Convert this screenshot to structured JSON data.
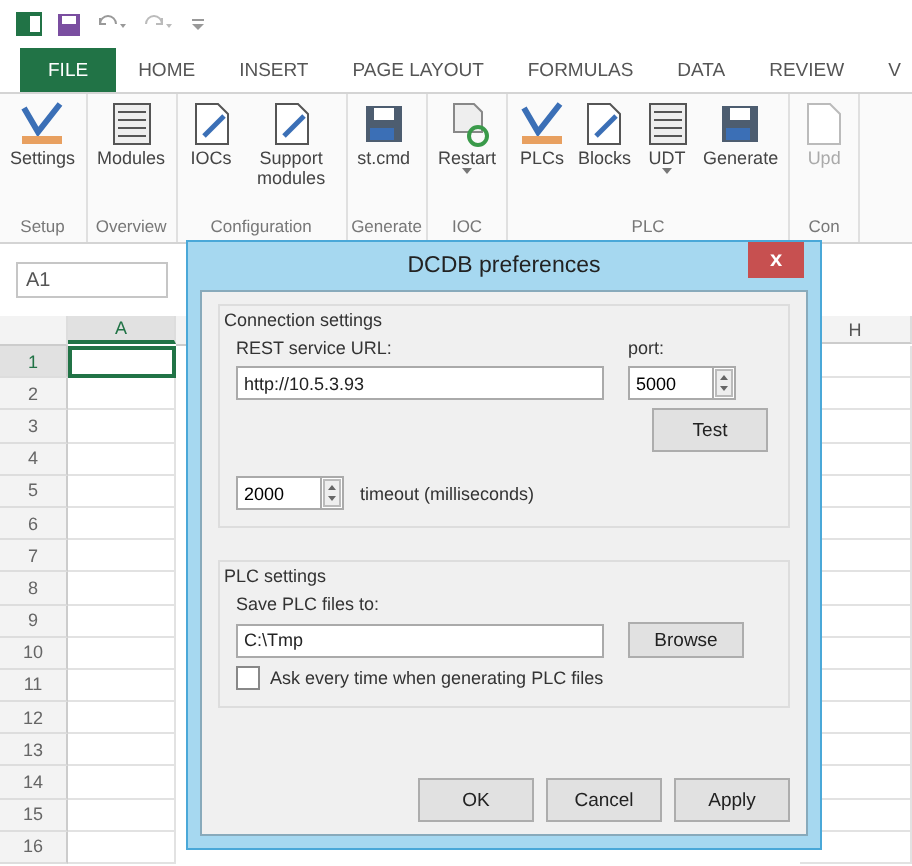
{
  "tabs": [
    {
      "label": "FILE",
      "kind": "file"
    },
    {
      "label": "HOME",
      "kind": "tab"
    },
    {
      "label": "INSERT",
      "kind": "tab"
    },
    {
      "label": "PAGE LAYOUT",
      "kind": "tab"
    },
    {
      "label": "FORMULAS",
      "kind": "tab"
    },
    {
      "label": "DATA",
      "kind": "tab"
    },
    {
      "label": "REVIEW",
      "kind": "tab"
    },
    {
      "label": "V",
      "kind": "tab"
    }
  ],
  "ribbon_groups": [
    {
      "label": "Setup",
      "buttons": [
        {
          "label": "Settings",
          "kind": "settings",
          "dropdown": false,
          "disabled": false
        }
      ]
    },
    {
      "label": "Overview",
      "buttons": [
        {
          "label": "Modules",
          "kind": "list",
          "dropdown": false,
          "disabled": false
        }
      ]
    },
    {
      "label": "Configuration",
      "buttons": [
        {
          "label": "IOCs",
          "kind": "doc",
          "dropdown": false,
          "disabled": false
        },
        {
          "label": "Support modules",
          "kind": "doc",
          "dropdown": false,
          "disabled": false
        }
      ]
    },
    {
      "label": "Generate",
      "buttons": [
        {
          "label": "st.cmd",
          "kind": "save",
          "dropdown": false,
          "disabled": false
        }
      ]
    },
    {
      "label": "IOC",
      "buttons": [
        {
          "label": "Restart",
          "kind": "restart",
          "dropdown": true,
          "disabled": false
        }
      ]
    },
    {
      "label": "PLC",
      "buttons": [
        {
          "label": "PLCs",
          "kind": "settings",
          "dropdown": false,
          "disabled": false
        },
        {
          "label": "Blocks",
          "kind": "doc",
          "dropdown": false,
          "disabled": false
        },
        {
          "label": "UDT",
          "kind": "list",
          "dropdown": true,
          "disabled": false
        },
        {
          "label": "Generate",
          "kind": "save",
          "dropdown": false,
          "disabled": false
        }
      ]
    },
    {
      "label": "Con",
      "buttons": [
        {
          "label": "Upd",
          "kind": "doc",
          "dropdown": false,
          "disabled": true
        }
      ]
    }
  ],
  "name_box": "A1",
  "sheet": {
    "columns": [
      {
        "label": "A",
        "selected": true
      },
      {
        "label": "H",
        "selected": false
      }
    ],
    "rows": [
      {
        "label": "1",
        "selected": true
      },
      {
        "label": "2",
        "selected": false
      },
      {
        "label": "3",
        "selected": false
      },
      {
        "label": "4",
        "selected": false
      },
      {
        "label": "5",
        "selected": false
      },
      {
        "label": "6",
        "selected": false
      },
      {
        "label": "7",
        "selected": false
      },
      {
        "label": "8",
        "selected": false
      },
      {
        "label": "9",
        "selected": false
      },
      {
        "label": "10",
        "selected": false
      },
      {
        "label": "11",
        "selected": false
      },
      {
        "label": "12",
        "selected": false
      },
      {
        "label": "13",
        "selected": false
      },
      {
        "label": "14",
        "selected": false
      },
      {
        "label": "15",
        "selected": false
      },
      {
        "label": "16",
        "selected": false
      }
    ]
  },
  "dialog": {
    "title": "DCDB preferences",
    "close": "x",
    "connection": {
      "legend": "Connection settings",
      "url_label": "REST service URL:",
      "url": "http://10.5.3.93",
      "port_label": "port:",
      "port": "5000",
      "test": "Test",
      "timeout": "2000",
      "timeout_label": "timeout (milliseconds)"
    },
    "plc": {
      "legend": "PLC settings",
      "path_label": "Save PLC files to:",
      "path": "C:\\Tmp",
      "browse": "Browse",
      "ask_label": "Ask every time when generating PLC files",
      "ask_checked": false
    },
    "buttons": [
      "OK",
      "Cancel",
      "Apply"
    ]
  }
}
